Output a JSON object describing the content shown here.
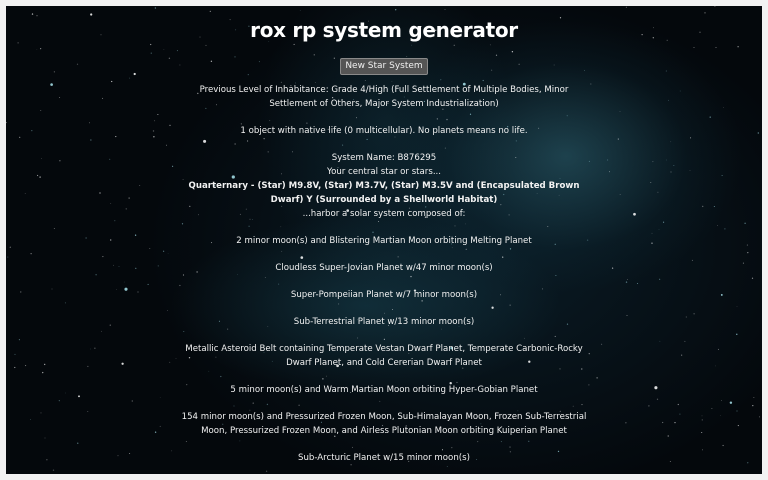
{
  "page": {
    "title": "rox rp system generator",
    "new_button_label": "New Star System"
  },
  "summary": {
    "habitation": "Previous Level of Inhabitance: Grade 4/High (Full Settlement of Multiple Bodies, Minor Settlement of Others, Major System Industrialization)",
    "life": "1 object with native life (0 multicellular). No planets means no life."
  },
  "system": {
    "name": "System Name: B876295",
    "star_intro": "Your central star or stars...",
    "stars": "Quarternary - (Star) M9.8V, (Star) M3.7V, (Star) M3.5V and (Encapsulated Brown Dwarf) Y (Surrounded by a Shellworld Habitat)",
    "system_intro": "...harbor a solar system composed of:"
  },
  "bodies": [
    "2 minor moon(s) and Blistering Martian Moon orbiting Melting Planet",
    "Cloudless Super-Jovian Planet w/47 minor moon(s)",
    "Super-Pompeiian Planet w/7 minor moon(s)",
    "Sub-Terrestrial Planet w/13 minor moon(s)",
    "Metallic Asteroid Belt containing Temperate Vestan Dwarf Planet, Temperate Carbonic-Rocky Dwarf Planet, and Cold Cererian Dwarf Planet",
    "5 minor moon(s) and Warm Martian Moon orbiting Hyper-Gobian Planet",
    "154 minor moon(s) and Pressurized Frozen Moon, Sub-Himalayan Moon, Frozen Sub-Terrestrial Moon, Pressurized Frozen Moon, and Airless Plutonian Moon orbiting Kuiperian Planet",
    "Sub-Arcturic Planet w/15 minor moon(s)"
  ]
}
